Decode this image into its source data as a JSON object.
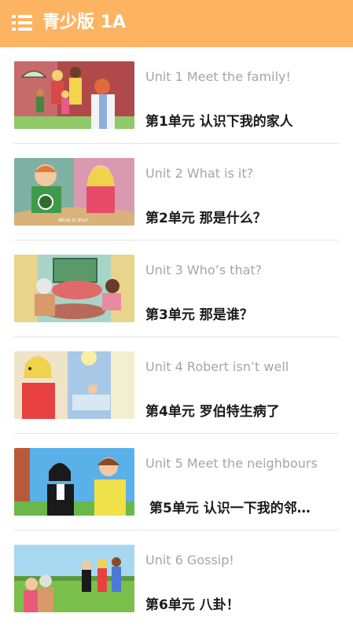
{
  "header": {
    "title": "青少版 1A",
    "menu_icon": "list-menu-icon"
  },
  "colors": {
    "header_bg": "#fdb462",
    "en_text": "#a5a5a5",
    "cn_text": "#1a1a1a"
  },
  "units": [
    {
      "en": "Unit 1 Meet the family!",
      "cn": "第1单元 认识下我的家人",
      "thumb_caption": ""
    },
    {
      "en": "Unit 2 What is it?",
      "cn": "第2单元 那是什么？",
      "thumb_caption": "What is this?"
    },
    {
      "en": "Unit 3 Who’s that?",
      "cn": "第3单元 那是谁？",
      "thumb_caption": ""
    },
    {
      "en": "Unit 4 Robert isn’t well",
      "cn": "第4单元 罗伯特生病了",
      "thumb_caption": ""
    },
    {
      "en": "Unit 5 Meet the neighbours",
      "cn": "第5单元 认识一下我的邻…",
      "thumb_caption": ""
    },
    {
      "en": "Unit 6 Gossip!",
      "cn": "第6单元 八卦！",
      "thumb_caption": ""
    }
  ]
}
